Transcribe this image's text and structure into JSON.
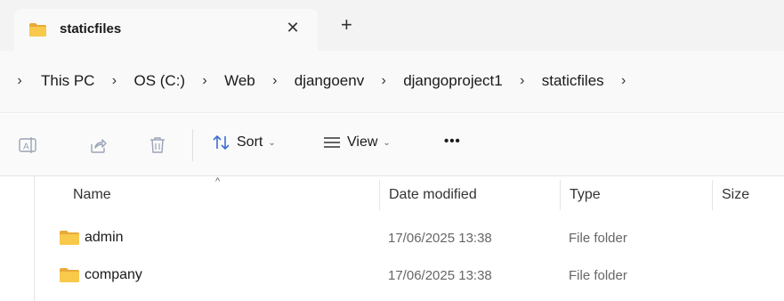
{
  "tab": {
    "title": "staticfiles",
    "close": "✕",
    "new_tab": "+"
  },
  "breadcrumb": {
    "items": [
      "This PC",
      "OS (C:)",
      "Web",
      "djangoenv",
      "djangoproject1",
      "staticfiles"
    ],
    "separator": "›"
  },
  "toolbar": {
    "sort_label": "Sort",
    "view_label": "View",
    "more_label": "•••",
    "dropdown_chevron": "⌄"
  },
  "columns": {
    "name": "Name",
    "date": "Date modified",
    "type": "Type",
    "size": "Size",
    "sort_caret": "^"
  },
  "rows": [
    {
      "name": "admin",
      "date": "17/06/2025 13:38",
      "type": "File folder"
    },
    {
      "name": "company",
      "date": "17/06/2025 13:38",
      "type": "File folder"
    }
  ],
  "colors": {
    "folder": "#f8c94a",
    "folder_dark": "#e8a93a",
    "icon_gray": "#8a8a8a",
    "tab_bg": "#f9f9f9",
    "bar_bg": "#f3f3f3"
  },
  "icons": [
    "folder-icon",
    "close-icon",
    "plus-icon",
    "rename-icon",
    "share-icon",
    "delete-icon",
    "sort-icon",
    "view-icon",
    "more-icon"
  ]
}
